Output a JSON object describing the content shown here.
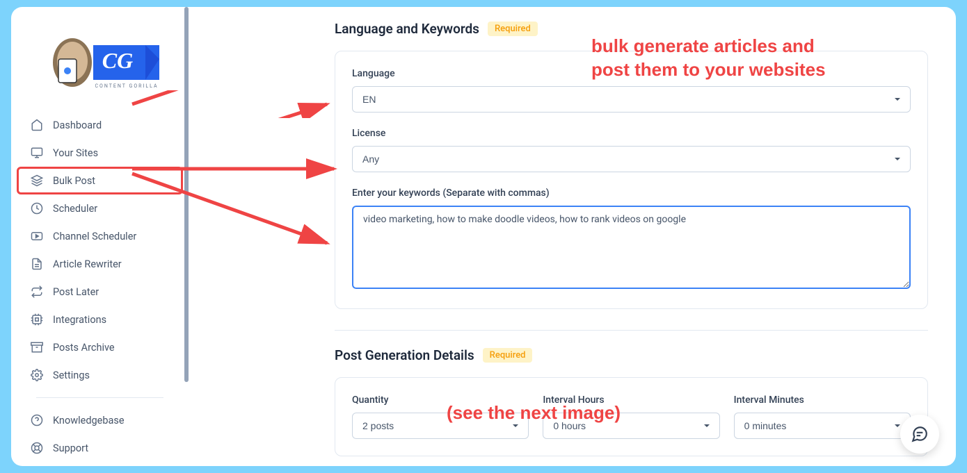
{
  "sidebar": {
    "items": [
      {
        "label": "Dashboard",
        "icon": "home"
      },
      {
        "label": "Your Sites",
        "icon": "monitor"
      },
      {
        "label": "Bulk Post",
        "icon": "layers",
        "active": true
      },
      {
        "label": "Scheduler",
        "icon": "clock"
      },
      {
        "label": "Channel Scheduler",
        "icon": "youtube"
      },
      {
        "label": "Article Rewriter",
        "icon": "file"
      },
      {
        "label": "Post Later",
        "icon": "refresh"
      },
      {
        "label": "Integrations",
        "icon": "cpu"
      },
      {
        "label": "Posts Archive",
        "icon": "archive"
      },
      {
        "label": "Settings",
        "icon": "settings"
      }
    ],
    "footer_items": [
      {
        "label": "Knowledgebase",
        "icon": "help"
      },
      {
        "label": "Support",
        "icon": "life-buoy"
      }
    ]
  },
  "section1": {
    "title": "Language and Keywords",
    "required": "Required",
    "language_label": "Language",
    "language_value": "EN",
    "license_label": "License",
    "license_value": "Any",
    "keywords_label": "Enter your keywords (Separate with commas)",
    "keywords_value": "video marketing, how to make doodle videos, how to rank videos on google"
  },
  "section2": {
    "title": "Post Generation Details",
    "required": "Required",
    "quantity_label": "Quantity",
    "quantity_value": "2 posts",
    "interval_hours_label": "Interval Hours",
    "interval_hours_value": "0 hours",
    "interval_minutes_label": "Interval Minutes",
    "interval_minutes_value": "0 minutes"
  },
  "annotations": {
    "text1": "bulk generate articles and\npost them to your websites",
    "text2": "(see the next image)"
  }
}
